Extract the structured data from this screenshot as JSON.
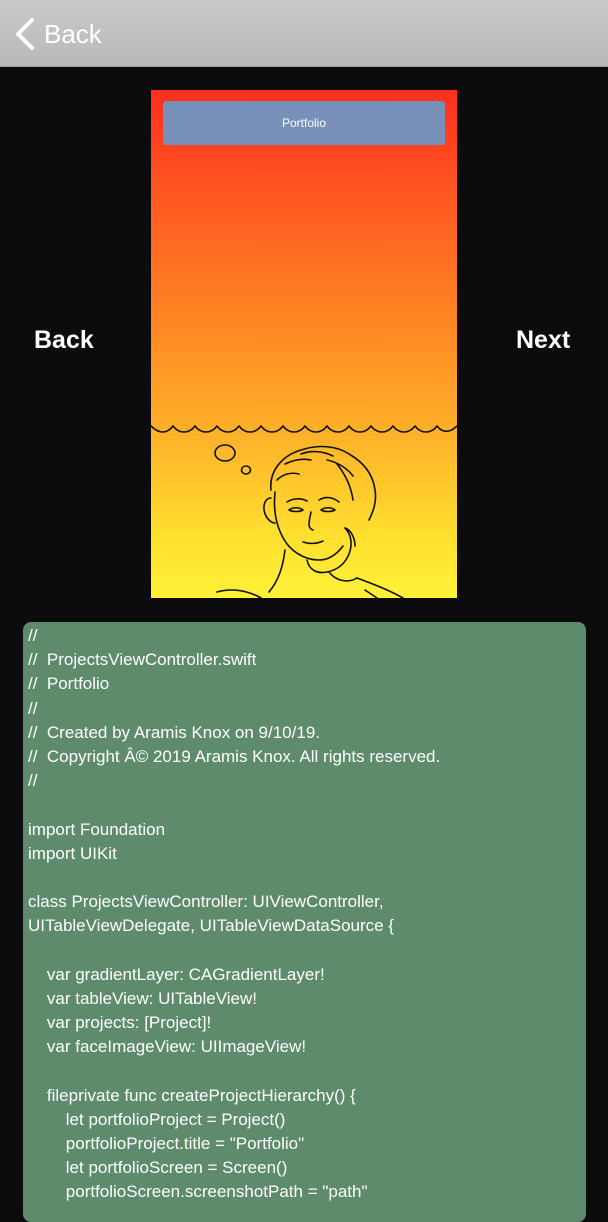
{
  "navbar": {
    "back_label": "Back"
  },
  "pager": {
    "back_label": "Back",
    "next_label": "Next"
  },
  "preview": {
    "header_title": "Portfolio"
  },
  "code": {
    "lines": [
      "//",
      "//  ProjectsViewController.swift",
      "//  Portfolio",
      "//",
      "//  Created by Aramis Knox on 9/10/19.",
      "//  Copyright Â© 2019 Aramis Knox. All rights reserved.",
      "//",
      "",
      "import Foundation",
      "import UIKit",
      "",
      "class ProjectsViewController: UIViewController,",
      "UITableViewDelegate, UITableViewDataSource {",
      "",
      "    var gradientLayer: CAGradientLayer!",
      "    var tableView: UITableView!",
      "    var projects: [Project]!",
      "    var faceImageView: UIImageView!",
      "",
      "    fileprivate func createProjectHierarchy() {",
      "        let portfolioProject = Project()",
      "        portfolioProject.title = \"Portfolio\"",
      "        let portfolioScreen = Screen()",
      "        portfolioScreen.screenshotPath = \"path\""
    ]
  },
  "colors": {
    "navbar": "#c0c0c0",
    "background": "#0c0c0e",
    "code_panel": "#5e8b6c",
    "preview_header": "#7690b9",
    "gradient_top": "#ff2e1f",
    "gradient_bottom": "#fff138"
  }
}
